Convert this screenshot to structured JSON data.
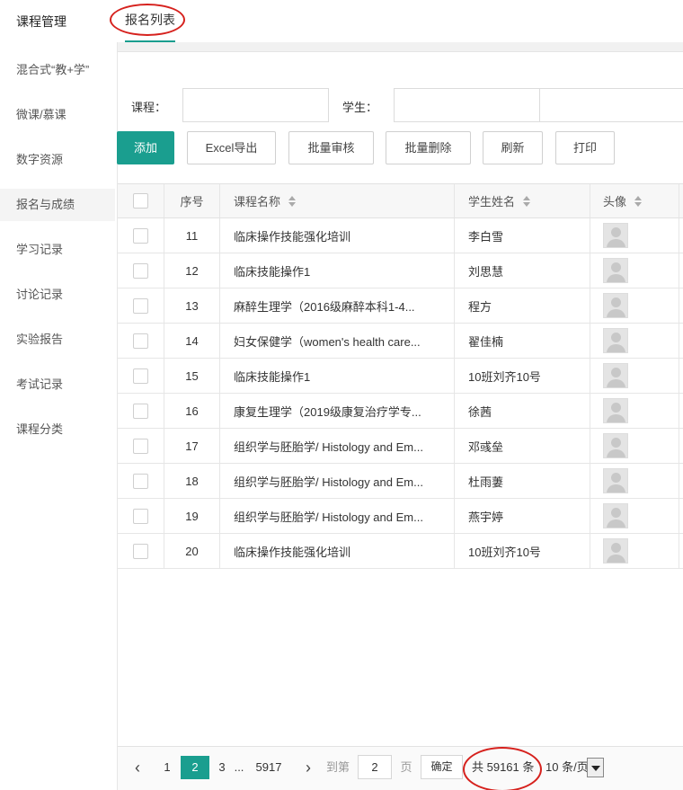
{
  "sidebar": {
    "title": "课程管理",
    "items": [
      {
        "label": "混合式“教+学”"
      },
      {
        "label": "微课/慕课"
      },
      {
        "label": "数字资源"
      },
      {
        "label": "报名与成绩"
      },
      {
        "label": "学习记录"
      },
      {
        "label": "讨论记录"
      },
      {
        "label": "实验报告"
      },
      {
        "label": "考试记录"
      },
      {
        "label": "课程分类"
      }
    ],
    "active_index": 3
  },
  "tabs": [
    {
      "label": "报名列表"
    }
  ],
  "filters": {
    "course_label": "课程：",
    "course_value": "",
    "student_label": "学生：",
    "student_value": ""
  },
  "toolbar": {
    "add_label": "添加",
    "excel_label": "Excel导出",
    "batch_review_label": "批量审核",
    "batch_delete_label": "批量删除",
    "refresh_label": "刷新",
    "print_label": "打印"
  },
  "table": {
    "columns": {
      "no": "序号",
      "course": "课程名称",
      "student": "学生姓名",
      "avatar": "头像"
    },
    "rows": [
      {
        "no": "11",
        "course": "临床操作技能强化培训",
        "student": "李白雪"
      },
      {
        "no": "12",
        "course": "临床技能操作1",
        "student": "刘思慧"
      },
      {
        "no": "13",
        "course": "麻醉生理学（2016级麻醉本科1-4...",
        "student": "程方"
      },
      {
        "no": "14",
        "course": "妇女保健学（women's health care...",
        "student": "翟佳楠"
      },
      {
        "no": "15",
        "course": "临床技能操作1",
        "student": "10班刘齐10号"
      },
      {
        "no": "16",
        "course": "康复生理学（2019级康复治疗学专...",
        "student": "徐茜"
      },
      {
        "no": "17",
        "course": "组织学与胚胎学/ Histology and Em...",
        "student": "邓彧垒"
      },
      {
        "no": "18",
        "course": "组织学与胚胎学/ Histology and Em...",
        "student": "杜雨萋"
      },
      {
        "no": "19",
        "course": "组织学与胚胎学/ Histology and Em...",
        "student": "燕宇婷"
      },
      {
        "no": "20",
        "course": "临床操作技能强化培训",
        "student": "10班刘齐10号"
      }
    ]
  },
  "pagination": {
    "prev": "‹",
    "next": "›",
    "pages": [
      "1",
      "2",
      "3"
    ],
    "current_page": "2",
    "ellipsis": "...",
    "last_page": "5917",
    "goto_label": "到第",
    "goto_value": "2",
    "page_unit": "页",
    "confirm_label": "确定",
    "total_label": "共 59161 条",
    "page_size_label": "10 条/页"
  },
  "colors": {
    "accent": "#1a9e8f",
    "annotation": "#d6211d"
  }
}
